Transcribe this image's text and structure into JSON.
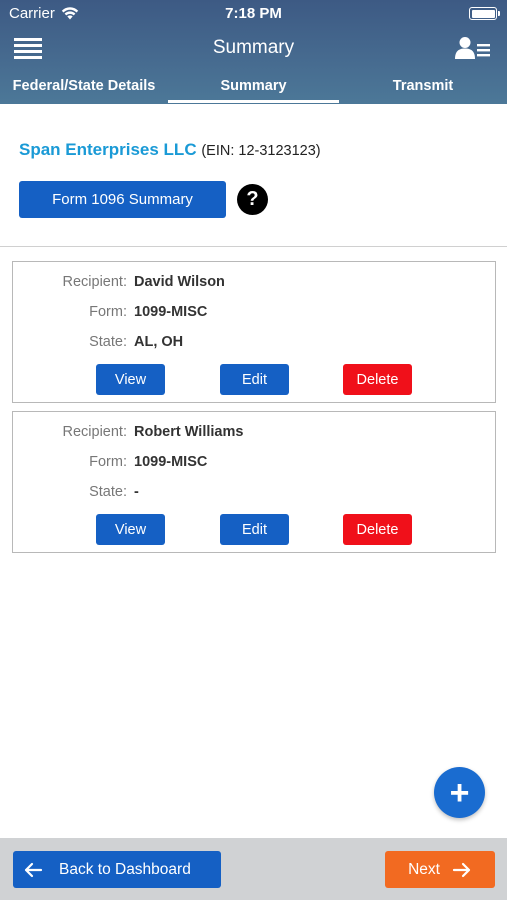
{
  "status_bar": {
    "carrier": "Carrier",
    "time": "7:18 PM"
  },
  "nav": {
    "title": "Summary"
  },
  "tabs": [
    {
      "label": "Federal/State Details",
      "active": false
    },
    {
      "label": "Summary",
      "active": true
    },
    {
      "label": "Transmit",
      "active": false
    }
  ],
  "company": {
    "name": "Span Enterprises LLC",
    "ein": "(EIN: 12-3123123)"
  },
  "form1096_button": "Form 1096 Summary",
  "help_icon_glyph": "?",
  "field_labels": {
    "recipient": "Recipient:",
    "form": "Form:",
    "state": "State:"
  },
  "recipients": [
    {
      "recipient": "David Wilson",
      "form": "1099-MISC",
      "state": "AL, OH"
    },
    {
      "recipient": "Robert Williams",
      "form": "1099-MISC",
      "state": "-"
    }
  ],
  "card_actions": {
    "view": "View",
    "edit": "Edit",
    "delete": "Delete"
  },
  "fab_glyph": "+",
  "footer": {
    "back_label": "Back to Dashboard",
    "next_label": "Next"
  },
  "colors": {
    "header_gradient": [
      "#3d5a84",
      "#4c7898"
    ],
    "company_name": "#1a9ad6",
    "primary_button": "#1560c4",
    "delete_button": "#f0101a",
    "next_button": "#f26a21",
    "footer_bg": "#d0d2d4"
  },
  "icons": {
    "menu": "hamburger-icon",
    "user": "user-list-icon",
    "wifi": "wifi-icon",
    "battery": "battery-icon",
    "help": "question-circle-icon",
    "add": "plus-icon",
    "back": "arrow-left-icon",
    "next": "arrow-right-icon"
  }
}
